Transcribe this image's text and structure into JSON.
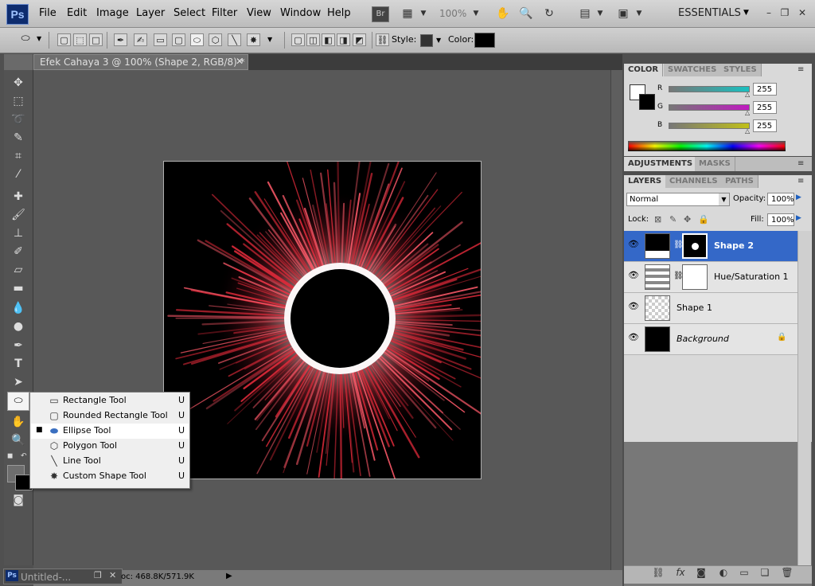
{
  "app": {
    "logo": "Ps",
    "menus": [
      "File",
      "Edit",
      "Image",
      "Layer",
      "Select",
      "Filter",
      "View",
      "Window",
      "Help"
    ],
    "zoom": "100%",
    "workspace": "ESSENTIALS",
    "bridge_label": "Br"
  },
  "options": {
    "style_label": "Style:",
    "color_label": "Color:",
    "color_value": "#000000"
  },
  "document": {
    "tab_title": "Efek Cahaya 3 @ 100% (Shape 2, RGB/8) *",
    "close": "✕",
    "minimized_title": "Untitled-...",
    "status": "oc: 468.8K/571.9K"
  },
  "flyout": {
    "items": [
      {
        "label": "Rectangle Tool",
        "key": "U",
        "icon": "rectangle-icon",
        "selected": false
      },
      {
        "label": "Rounded Rectangle Tool",
        "key": "U",
        "icon": "rounded-rectangle-icon",
        "selected": false
      },
      {
        "label": "Ellipse Tool",
        "key": "U",
        "icon": "ellipse-icon",
        "selected": true
      },
      {
        "label": "Polygon Tool",
        "key": "U",
        "icon": "polygon-icon",
        "selected": false
      },
      {
        "label": "Line Tool",
        "key": "U",
        "icon": "line-icon",
        "selected": false
      },
      {
        "label": "Custom Shape Tool",
        "key": "U",
        "icon": "custom-shape-icon",
        "selected": false
      }
    ]
  },
  "color_panel": {
    "tabs": [
      "COLOR",
      "SWATCHES",
      "STYLES"
    ],
    "channels": [
      {
        "label": "R",
        "value": "255",
        "color": "#19c0c0"
      },
      {
        "label": "G",
        "value": "255",
        "color": "#c01ac0"
      },
      {
        "label": "B",
        "value": "255",
        "color": "#c0c019"
      }
    ]
  },
  "adjustments_panel": {
    "tabs": [
      "ADJUSTMENTS",
      "MASKS"
    ]
  },
  "layers_panel": {
    "tabs": [
      "LAYERS",
      "CHANNELS",
      "PATHS"
    ],
    "blend_mode": "Normal",
    "opacity_label": "Opacity:",
    "opacity": "100%",
    "lock_label": "Lock:",
    "fill_label": "Fill:",
    "fill": "100%",
    "layers": [
      {
        "name": "Shape 2",
        "selected": true
      },
      {
        "name": "Hue/Saturation 1",
        "selected": false
      },
      {
        "name": "Shape 1",
        "selected": false
      },
      {
        "name": "Background",
        "selected": false,
        "locked": true
      }
    ]
  }
}
